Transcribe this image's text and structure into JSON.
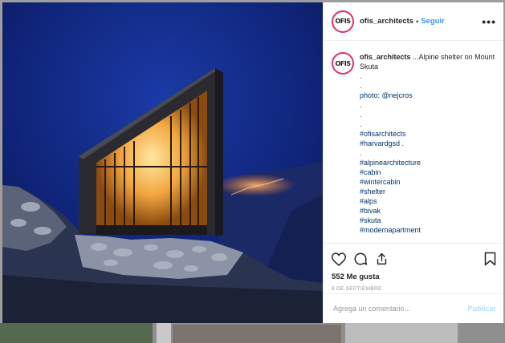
{
  "post": {
    "username": "ofis_architects",
    "avatar_text": "OFIS",
    "separator": "•",
    "follow_label": "Seguir",
    "more_label": "•••"
  },
  "caption": {
    "username": "ofis_architects",
    "intro": " ...Alpine shelter on Mount Skuta",
    "lines": [
      ".",
      ".",
      "photo: @nejcros",
      ".",
      ".",
      ".",
      "#ofisarchitects",
      "#harvardgsd .",
      ".",
      "#alpinearchitecture",
      "#cabin",
      "#wintercabin",
      "#shelter",
      "#alps",
      "#bivak",
      "#skuta",
      "#modernapartment"
    ]
  },
  "actions": {
    "like_icon": "heart-icon",
    "comment_icon": "comment-icon",
    "share_icon": "share-icon",
    "save_icon": "bookmark-icon"
  },
  "likes": "552 Me gusta",
  "date": "8 DE SEPTIEMBRE",
  "comment": {
    "placeholder": "Agrega un comentario...",
    "publish_label": "Publicar"
  },
  "colors": {
    "link": "#3897f0",
    "hashtag": "#003569",
    "publish_disabled": "#b2dffc",
    "story_ring": "#e1306c"
  }
}
